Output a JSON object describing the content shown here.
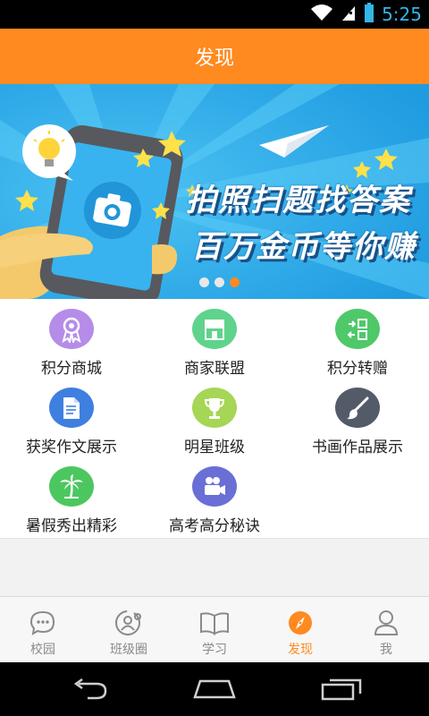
{
  "status_bar": {
    "time": "5:25"
  },
  "header": {
    "title": "发现"
  },
  "banner": {
    "line1": "拍照扫题找答案",
    "line2": "百万金币等你赚",
    "slide_count": 3,
    "active_slide": 3
  },
  "features": [
    {
      "label": "积分商城",
      "icon": "award-ribbon-icon",
      "color": "#b58ce8"
    },
    {
      "label": "商家联盟",
      "icon": "storefront-icon",
      "color": "#5fd38c"
    },
    {
      "label": "积分转赠",
      "icon": "transfer-icon",
      "color": "#4fc86a"
    },
    {
      "label": "获奖作文展示",
      "icon": "document-icon",
      "color": "#3f7fe0"
    },
    {
      "label": "明星班级",
      "icon": "trophy-icon",
      "color": "#a6d656"
    },
    {
      "label": "书画作品展示",
      "icon": "paintbrush-icon",
      "color": "#545b68"
    },
    {
      "label": "暑假秀出精彩",
      "icon": "palm-tree-icon",
      "color": "#4cc760"
    },
    {
      "label": "高考高分秘诀",
      "icon": "video-camera-icon",
      "color": "#6a6fd6"
    }
  ],
  "tabs": [
    {
      "label": "校园",
      "icon": "chat-bubble-icon",
      "active": false
    },
    {
      "label": "班级圈",
      "icon": "class-circle-icon",
      "active": false
    },
    {
      "label": "学习",
      "icon": "book-icon",
      "active": false
    },
    {
      "label": "发现",
      "icon": "compass-icon",
      "active": true
    },
    {
      "label": "我",
      "icon": "user-icon",
      "active": false
    }
  ],
  "colors": {
    "accent": "#ff8a1f",
    "tab_inactive": "#8a8a8a",
    "banner_bg": "#28a6e8"
  }
}
